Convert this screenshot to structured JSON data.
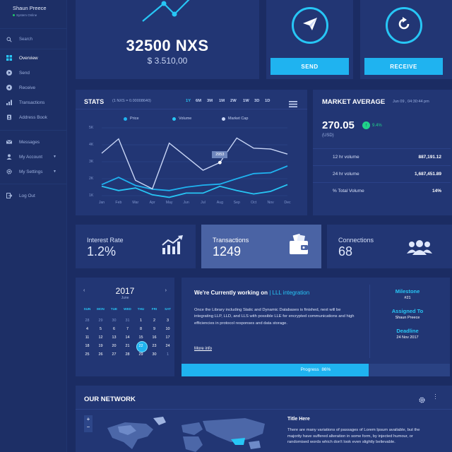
{
  "user": {
    "name": "Shaun Preece",
    "status": "System Online"
  },
  "search": {
    "label": "Search"
  },
  "nav": [
    {
      "label": "Overview",
      "icon": "grid-icon"
    },
    {
      "label": "Send",
      "icon": "play-circle-icon"
    },
    {
      "label": "Receive",
      "icon": "receive-circle-icon"
    },
    {
      "label": "Transactions",
      "icon": "bar-chart-icon"
    },
    {
      "label": "Address Book",
      "icon": "address-book-icon"
    },
    {
      "label": "Messages",
      "icon": "envelope-icon"
    },
    {
      "label": "My Account",
      "icon": "user-icon"
    },
    {
      "label": "My Settings",
      "icon": "gear-icon"
    },
    {
      "label": "Log Out",
      "icon": "logout-icon"
    }
  ],
  "balance": {
    "amount": "32500 NXS",
    "usd": "$ 3.510,00"
  },
  "actions": {
    "send": "SEND",
    "receive": "RECEIVE"
  },
  "stats": {
    "title": "STATS",
    "rate": "(1 NXS = 0.00008640)",
    "periods": [
      "1Y",
      "6M",
      "3M",
      "1M",
      "2W",
      "1W",
      "3D",
      "1D"
    ],
    "active_period": "1Y",
    "tooltip": "2953"
  },
  "chart_data": {
    "type": "line",
    "categories": [
      "Jan",
      "Feb",
      "Mar",
      "Apr",
      "May",
      "Jun",
      "Jul",
      "Aug",
      "Sep",
      "Oct",
      "Nov",
      "Dec"
    ],
    "y_ticks": [
      "5K",
      "4K",
      "3K",
      "2K",
      "1K"
    ],
    "ylim": [
      500,
      5000
    ],
    "legend_position": "top",
    "series": [
      {
        "name": "Price",
        "color": "#1fb3f0",
        "values": [
          1650,
          2080,
          1600,
          1380,
          1300,
          1500,
          1620,
          1680,
          2000,
          2300,
          2350,
          2750
        ]
      },
      {
        "name": "Volume",
        "color": "#27c6f5",
        "values": [
          1550,
          1300,
          1450,
          1050,
          900,
          1150,
          1150,
          1550,
          1300,
          1100,
          1250,
          1650
        ]
      },
      {
        "name": "Market Cap",
        "color": "#c9d6f6",
        "values": [
          3500,
          4350,
          1900,
          1400,
          4100,
          3300,
          2500,
          2953,
          4400,
          3800,
          3750,
          3450
        ]
      }
    ]
  },
  "market": {
    "title": "MARKET AVERAGE",
    "date": "Jun 09 , 04:30:44 pm",
    "price": "270.05",
    "change": "9.4%",
    "unit": "(USD)",
    "rows": [
      {
        "label": "12 hr volume",
        "value": "887,191.12"
      },
      {
        "label": "24 hr volume",
        "value": "1,687,451.89"
      },
      {
        "label": "% Total Volume",
        "value": "14%"
      }
    ]
  },
  "cards": {
    "interest": {
      "label": "Interest Rate",
      "value": "1.2%"
    },
    "transactions": {
      "label": "Transactions",
      "value": "1249"
    },
    "connections": {
      "label": "Connections",
      "value": "68"
    }
  },
  "calendar": {
    "year": "2017",
    "month": "June",
    "days_header": [
      "SUN",
      "MON",
      "TUE",
      "WED",
      "THU",
      "FRI",
      "SAT"
    ],
    "weeks": [
      [
        "28",
        "29",
        "30",
        "31",
        "1",
        "2",
        "3"
      ],
      [
        "4",
        "5",
        "6",
        "7",
        "8",
        "9",
        "10"
      ],
      [
        "11",
        "12",
        "13",
        "14",
        "15",
        "16",
        "17"
      ],
      [
        "18",
        "19",
        "20",
        "21",
        "22",
        "23",
        "24"
      ],
      [
        "25",
        "26",
        "27",
        "28",
        "29",
        "30",
        "1"
      ]
    ],
    "today": "22"
  },
  "project": {
    "title_prefix": "We're Currently working on",
    "title_topic": "| LLL integration",
    "body": "Once the Library including Static and Dynamic Databases is finished, next will be integrating LLP, LLD, and LLS with possible LLE for encrypted communications and high efficiencies in protocol responses and data storage.",
    "more": "More info",
    "milestone_label": "Milestone",
    "milestone_value": "#21",
    "assigned_label": "Assigned To",
    "assigned_value": "Shaun Preece",
    "deadline_label": "Deadline",
    "deadline_value": "24 Nov 2017",
    "progress_label": "Progress",
    "progress_value": "86%",
    "progress_fraction": 0.86
  },
  "network": {
    "title": "OUR NETWORK",
    "side_title": "Title Here",
    "side_body": "There are many variations of passages of Lorem Ipsum available, but the majority have suffered alteration in some form, by injected humour, or randomised words which don't look even slightly believable."
  }
}
